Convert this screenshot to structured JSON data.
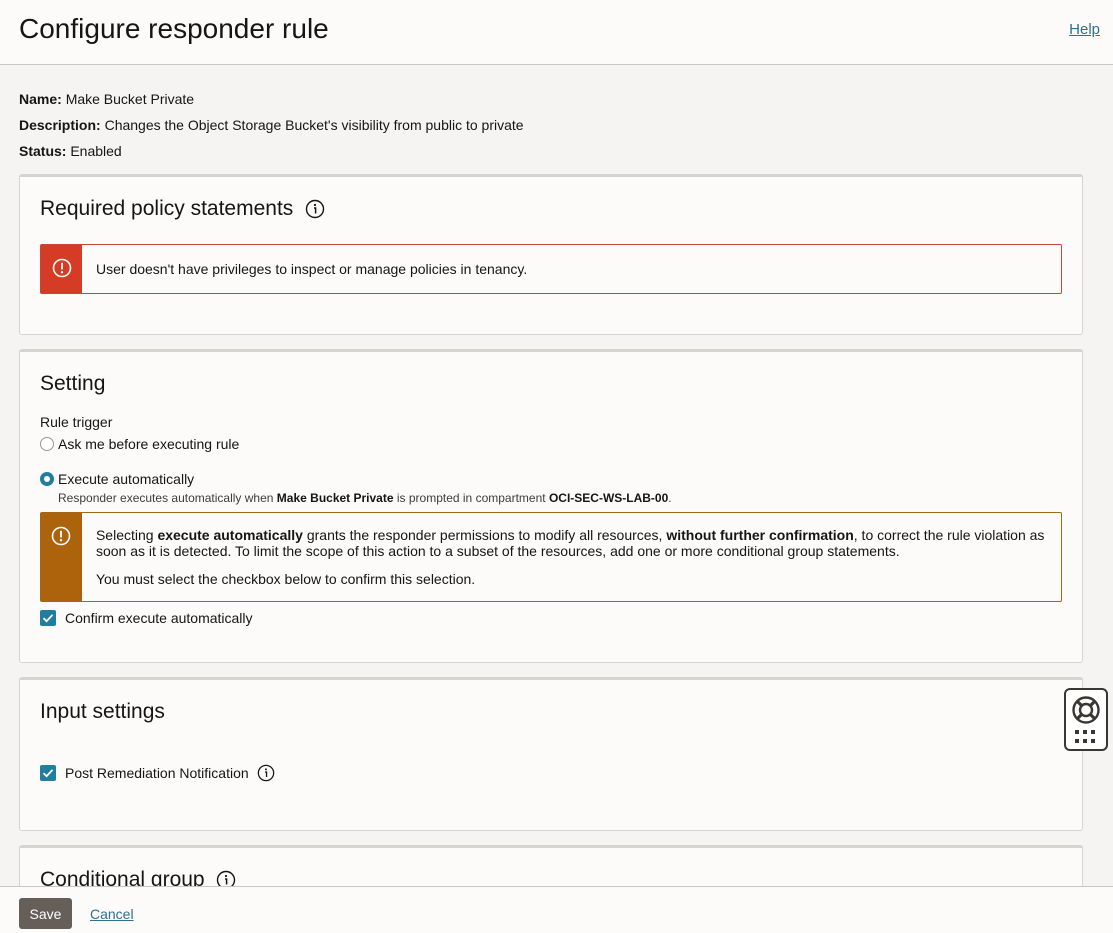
{
  "header": {
    "title": "Configure responder rule",
    "help_link": "Help"
  },
  "meta": {
    "name_label": "Name:",
    "name_value": "Make Bucket Private",
    "description_label": "Description:",
    "description_value": "Changes the Object Storage Bucket's visibility from public to private",
    "status_label": "Status:",
    "status_value": "Enabled"
  },
  "policy_panel": {
    "title": "Required policy statements",
    "info_icon": "info-icon",
    "error_message": "User doesn't have privileges to inspect or manage policies in tenancy."
  },
  "setting_panel": {
    "title": "Setting",
    "rule_trigger_label": "Rule trigger",
    "options": [
      {
        "label": "Ask me before executing rule",
        "selected": false
      },
      {
        "label": "Execute automatically",
        "selected": true
      }
    ],
    "execute_desc": {
      "prefix": "Responder executes automatically when ",
      "rule_name": "Make Bucket Private",
      "middle": " is prompted in compartment ",
      "compartment": "OCI-SEC-WS-LAB-00",
      "suffix": "."
    },
    "warning": {
      "part1": "Selecting ",
      "bold1": "execute automatically",
      "part2": " grants the responder permissions to modify all resources, ",
      "bold2": "without further confirmation",
      "part3": ", to correct the rule violation as soon as it is detected. To limit the scope of this action to a subset of the resources, add one or more conditional group statements.",
      "line2": "You must select the checkbox below to confirm this selection."
    },
    "confirm_checkbox": {
      "label": "Confirm execute automatically",
      "checked": true
    }
  },
  "input_panel": {
    "title": "Input settings",
    "notification_checkbox": {
      "label": "Post Remediation Notification",
      "checked": true
    }
  },
  "conditional_panel": {
    "title": "Conditional group"
  },
  "footer": {
    "save_label": "Save",
    "cancel_label": "Cancel"
  },
  "colors": {
    "accent": "#227e9e",
    "error": "#d63b25",
    "warning": "#ac630c",
    "save_button": "#665e58",
    "link": "#2f6f8f"
  }
}
